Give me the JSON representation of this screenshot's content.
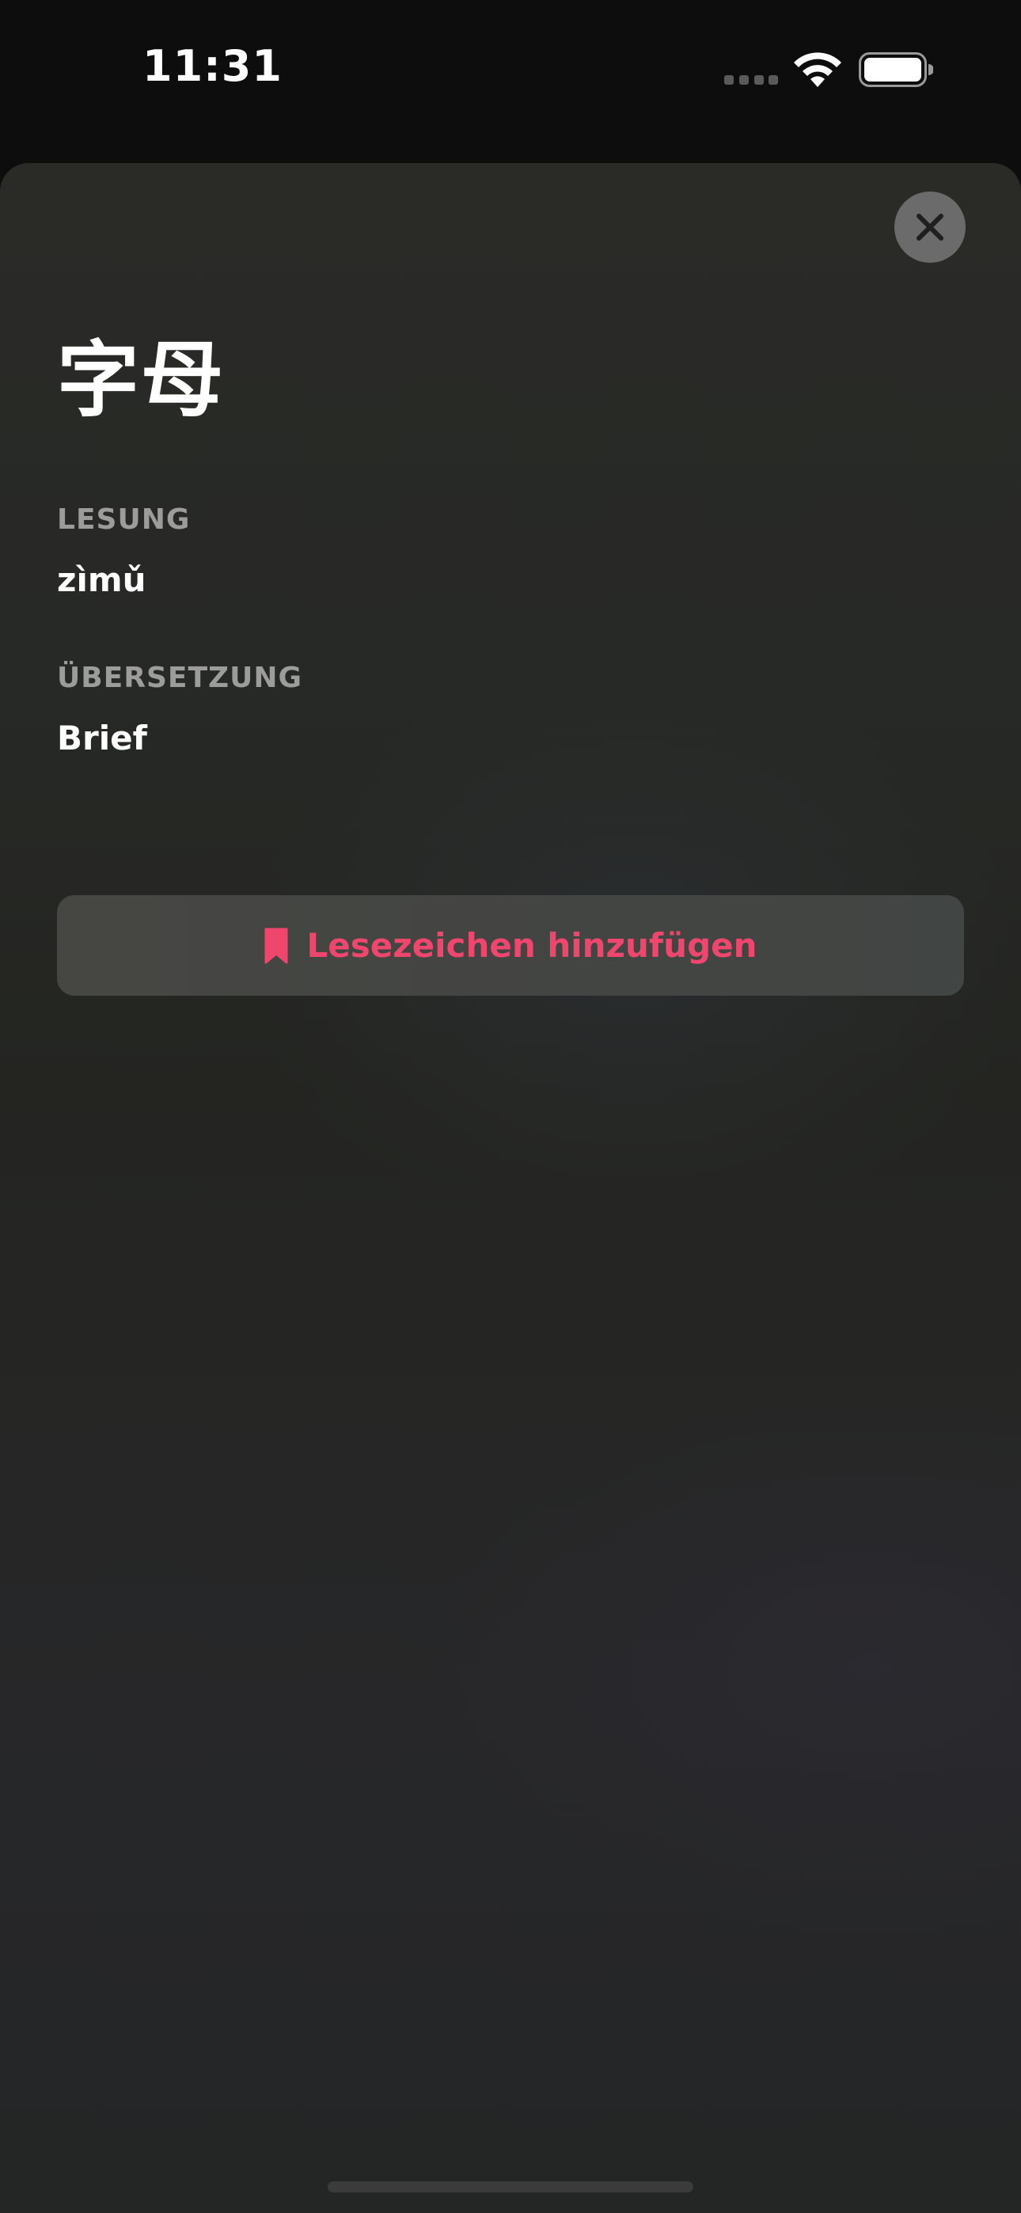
{
  "status_bar": {
    "time": "11:31",
    "signal_icon": "cellular-signal-icon",
    "wifi_icon": "wifi-icon",
    "battery_icon": "battery-icon"
  },
  "sheet": {
    "close_icon": "close-icon",
    "headword": "字母",
    "reading": {
      "label": "LESUNG",
      "value": "zìmǔ"
    },
    "translation": {
      "label": "ÜBERSETZUNG",
      "value": "Brief"
    },
    "bookmark_button": {
      "label": "Lesezeichen hinzufügen",
      "icon": "bookmark-icon"
    }
  },
  "colors": {
    "accent": "#f0466e",
    "label_gray": "#9c9c9a",
    "close_button_bg": "#6b6b6b"
  }
}
